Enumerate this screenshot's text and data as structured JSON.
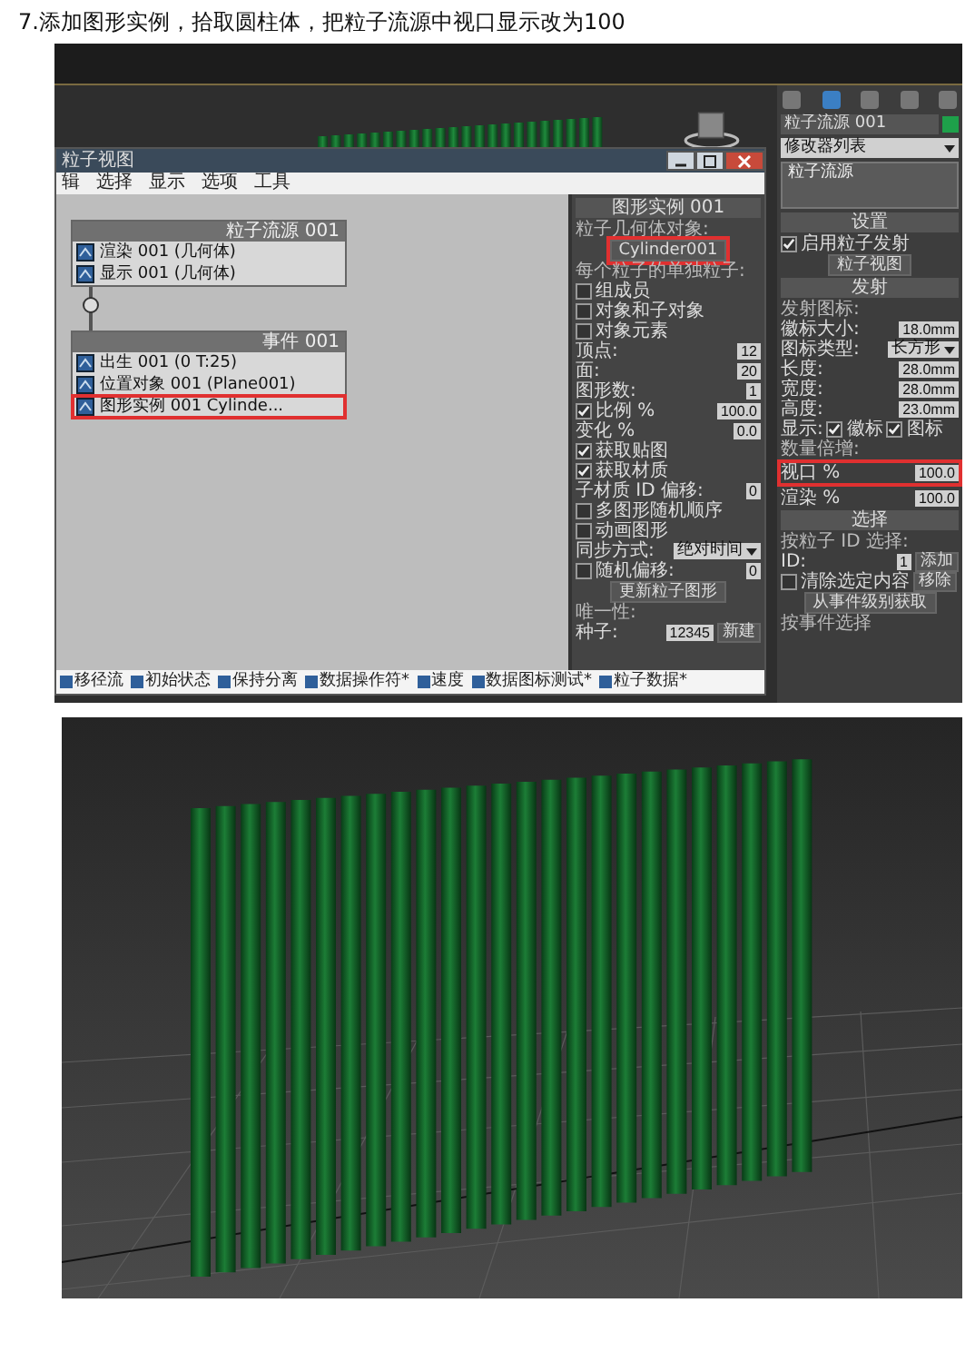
{
  "heading": "7.添加图形实例，拾取圆柱体，把粒子流源中视口显示改为100",
  "screenshot_1": {
    "particle_view": {
      "title": "粒子视图",
      "menu": [
        "辑",
        "选择",
        "显示",
        "选项",
        "工具"
      ],
      "nodes": [
        {
          "title": "粒子流源 001",
          "rows": [
            {
              "label": "渲染 001 (几何体)",
              "highlighted": false
            },
            {
              "label": "显示 001 (几何体)",
              "highlighted": false
            }
          ]
        },
        {
          "title": "事件 001",
          "rows": [
            {
              "label": "出生 001 (0 T:25)",
              "highlighted": false
            },
            {
              "label": "位置对象 001 (Plane001)",
              "highlighted": false
            },
            {
              "label": "图形实例 001 Cylinde...",
              "highlighted": true
            }
          ]
        }
      ],
      "depot": [
        "移径流",
        "初始状态",
        "保持分离",
        "数据操作符*",
        "速度",
        "数据图标测试*",
        "粒子数据*"
      ],
      "params": {
        "rollout": "图形实例 001",
        "rows": [
          {
            "kind": "group",
            "label": "粒子几何体对象:"
          },
          {
            "kind": "button",
            "label": "Cylinder001",
            "highlighted": true
          },
          {
            "kind": "group",
            "label": "每个粒子的单独粒子:"
          },
          {
            "kind": "check",
            "label": "组成员",
            "checked": false
          },
          {
            "kind": "check",
            "label": "对象和子对象",
            "checked": false
          },
          {
            "kind": "check",
            "label": "对象元素",
            "checked": false
          },
          {
            "kind": "value",
            "label": "顶点:",
            "value": "12"
          },
          {
            "kind": "value",
            "label": "面:",
            "value": "20"
          },
          {
            "kind": "value",
            "label": "图形数:",
            "value": "1"
          },
          {
            "kind": "check",
            "label": "比例 %",
            "checked": true,
            "value": "100.0"
          },
          {
            "kind": "value",
            "label": "变化 %",
            "value": "0.0"
          },
          {
            "kind": "check",
            "label": "获取贴图",
            "checked": true
          },
          {
            "kind": "check",
            "label": "获取材质",
            "checked": true
          },
          {
            "kind": "value",
            "label": "子材质 ID 偏移:",
            "value": "0"
          },
          {
            "kind": "check",
            "label": "多图形随机顺序",
            "checked": false
          },
          {
            "kind": "check",
            "label": "动画图形",
            "checked": false
          },
          {
            "kind": "dropdown",
            "label": "同步方式:",
            "value": "绝对时间"
          },
          {
            "kind": "check",
            "label": "随机偏移:",
            "checked": false,
            "value": "0"
          },
          {
            "kind": "button",
            "label": "更新粒子图形",
            "highlighted": false
          },
          {
            "kind": "group",
            "label": "唯一性:"
          },
          {
            "kind": "value",
            "label": "种子:",
            "value": "12345",
            "button": "新建"
          }
        ]
      }
    },
    "command_panel": {
      "object_name": "粒子流源 001",
      "modifier_list": "修改器列表",
      "stack": [
        "粒子流源"
      ],
      "rollouts": [
        {
          "title": "设置",
          "rows": [
            {
              "kind": "check",
              "label": "启用粒子发射",
              "checked": true
            },
            {
              "kind": "button",
              "label": "粒子视图",
              "highlighted": false
            }
          ]
        },
        {
          "title": "发射",
          "rows": [
            {
              "kind": "group",
              "label": "发射图标:"
            },
            {
              "kind": "value",
              "label": "徽标大小:",
              "value": "18.0mm"
            },
            {
              "kind": "dropdown",
              "label": "图标类型:",
              "value": "长方形"
            },
            {
              "kind": "value",
              "label": "长度:",
              "value": "28.0mm"
            },
            {
              "kind": "value",
              "label": "宽度:",
              "value": "28.0mm"
            },
            {
              "kind": "value",
              "label": "高度:",
              "value": "23.0mm"
            },
            {
              "kind": "pair",
              "label": "显示:",
              "items": [
                {
                  "label": "徽标",
                  "checked": true
                },
                {
                  "label": "图标",
                  "checked": true
                }
              ]
            },
            {
              "kind": "group",
              "label": "数量倍增:"
            },
            {
              "kind": "value",
              "label": "视口 %",
              "value": "100.0",
              "highlighted": true
            },
            {
              "kind": "value",
              "label": "渲染 %",
              "value": "100.0"
            }
          ]
        },
        {
          "title": "选择",
          "rows": [
            {
              "kind": "group",
              "label": "按粒子 ID 选择:"
            },
            {
              "kind": "value",
              "label": "ID:",
              "value": "1",
              "button": "添加"
            },
            {
              "kind": "check",
              "label": "清除选定内容",
              "checked": false,
              "button": "移除"
            },
            {
              "kind": "button",
              "label": "从事件级别获取",
              "highlighted": false
            },
            {
              "kind": "group",
              "label": "按事件选择"
            }
          ]
        }
      ]
    }
  }
}
